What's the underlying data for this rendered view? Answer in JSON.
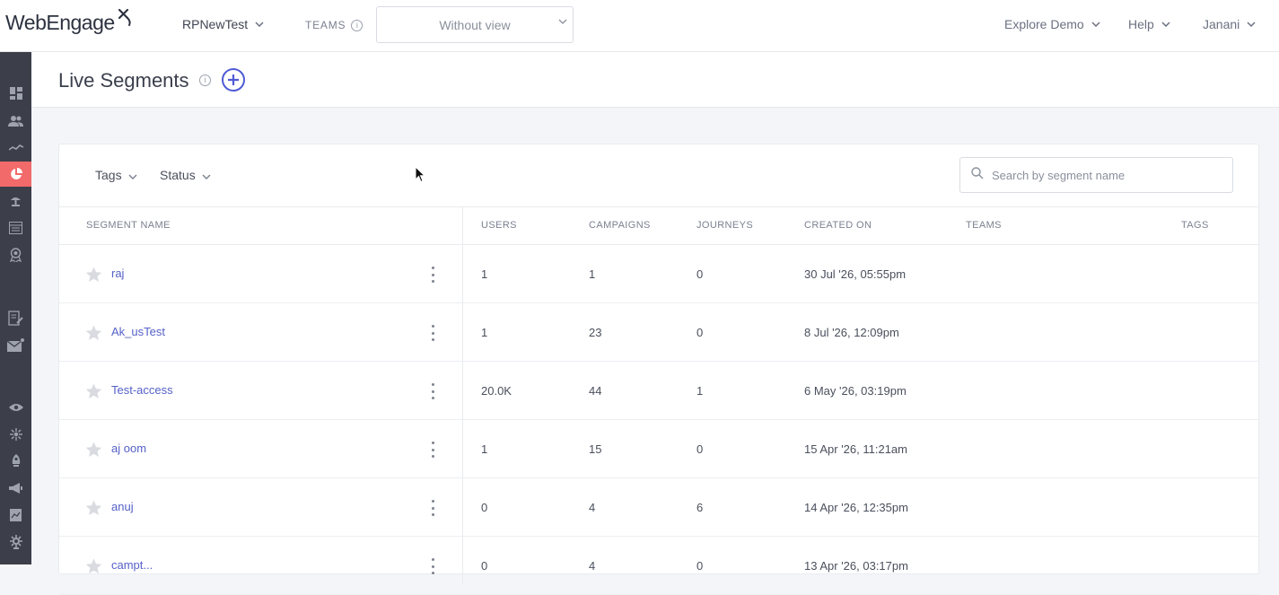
{
  "brand": {
    "logo_text": "WebEngage"
  },
  "topbar": {
    "project": "RPNewTest",
    "teams_label": "TEAMS",
    "teams_info": "i",
    "team_select_value": "Without view",
    "explore_demo": "Explore Demo",
    "help": "Help",
    "user": "Janani"
  },
  "colors": {
    "accent": "#4f5bd5",
    "active_rail": "#f26a6a",
    "rail_bg": "#3c3f4a",
    "link": "#5561c8"
  },
  "rail": {
    "icons": [
      "dashboard-icon",
      "users-icon",
      "analytics-icon",
      "segments-icon",
      "data-platform-icon",
      "catalog-icon",
      "relays-icon",
      "journeys-icon",
      "email-icon",
      "web-personalization-icon",
      "integrations-icon",
      "push-icon",
      "campaigns-icon",
      "reports-icon",
      "settings-icon"
    ],
    "active": "segments-icon"
  },
  "page": {
    "title": "Live Segments",
    "title_info": "i"
  },
  "filters": {
    "tags_label": "Tags",
    "status_label": "Status",
    "search_placeholder": "Search by segment name"
  },
  "table": {
    "headers": {
      "name": "SEGMENT NAME",
      "users": "USERS",
      "campaigns": "CAMPAIGNS",
      "journeys": "JOURNEYS",
      "created_on": "CREATED ON",
      "teams": "TEAMS",
      "tags": "TAGS"
    },
    "rows": [
      {
        "name": "raj",
        "users": "1",
        "campaigns": "1",
        "journeys": "0",
        "created_on": "30 Jul '26, 05:55pm"
      },
      {
        "name": "Ak_usTest",
        "users": "1",
        "campaigns": "23",
        "journeys": "0",
        "created_on": "8 Jul '26, 12:09pm"
      },
      {
        "name": "Test-access",
        "users": "20.0K",
        "campaigns": "44",
        "journeys": "1",
        "created_on": "6 May '26, 03:19pm"
      },
      {
        "name": "aj oom",
        "users": "1",
        "campaigns": "15",
        "journeys": "0",
        "created_on": "15 Apr '26, 11:21am"
      },
      {
        "name": "anuj",
        "users": "0",
        "campaigns": "4",
        "journeys": "6",
        "created_on": "14 Apr '26, 12:35pm"
      },
      {
        "name": "campt...",
        "users": "0",
        "campaigns": "4",
        "journeys": "0",
        "created_on": "13 Apr '26, 03:17pm"
      }
    ]
  }
}
